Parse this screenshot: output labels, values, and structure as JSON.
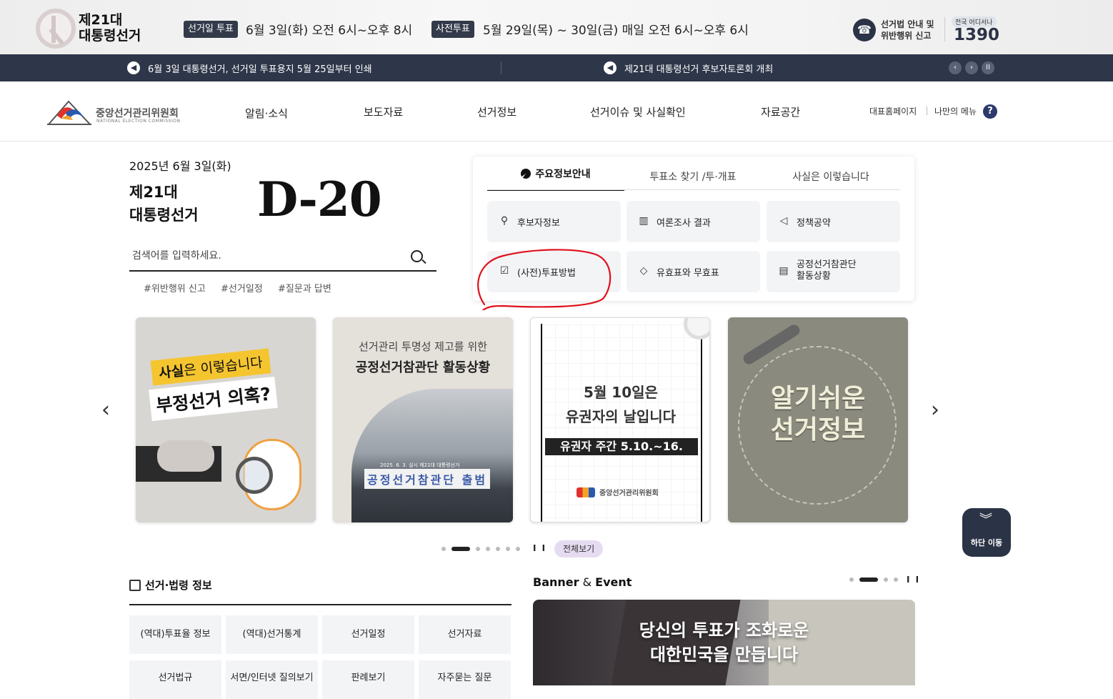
{
  "top_banner": {
    "title_line1": "제21대",
    "title_line2": "대통령선거",
    "election_day_badge": "선거일 투표",
    "election_day_text": "6월 3일(화) 오전 6시~오후 8시",
    "early_vote_badge": "사전투표",
    "early_vote_text": "5월 29일(목) ~ 30일(금) 매일 오전 6시~오후 6시",
    "hotline_line1": "선거법 안내 및",
    "hotline_line2": "위반행위 신고",
    "hotline_anywhere": "전국 어디서나",
    "hotline_number": "1390"
  },
  "ticker": {
    "items": [
      "6월 3일 대통령선거, 선거일 투표용지 5월 25일부터 인쇄",
      "제21대 대통령선거 후보자토론회 개최"
    ]
  },
  "nav": {
    "org_name": "중앙선거관리위원회",
    "org_name_en": "NATIONAL ELECTION COMMISSION",
    "items": [
      "알림·소식",
      "보도자료",
      "선거정보",
      "선거이슈 및 사실확인",
      "자료공간"
    ],
    "util_home": "대표홈페이지",
    "util_mymenu": "나만의 메뉴",
    "help": "?"
  },
  "hero": {
    "date": "2025년 6월 3일(화)",
    "election_line1": "제21대",
    "election_line2": "대통령선거",
    "dday": "D-20",
    "search_placeholder": "검색어를 입력하세요.",
    "hashtags": [
      "#위반행위 신고",
      "#선거일정",
      "#질문과 답변"
    ]
  },
  "info_panel": {
    "tabs": [
      "주요정보안내",
      "투표소 찾기 /투·개표",
      "사실은 이렇습니다"
    ],
    "buttons": [
      {
        "label": "후보자정보",
        "icon": "person-search-icon"
      },
      {
        "label": "여론조사 결과",
        "icon": "bar-chart-icon"
      },
      {
        "label": "정책공약",
        "icon": "megaphone-icon"
      },
      {
        "label": "(사전)투표방법",
        "icon": "ballot-box-icon"
      },
      {
        "label": "유효표와 무효표",
        "icon": "stamp-icon"
      },
      {
        "label": "공정선거참관단 활동상황",
        "label_line1": "공정선거참관단",
        "label_line2": "활동상황",
        "icon": "document-icon"
      }
    ]
  },
  "carousel": {
    "prev": "‹",
    "next": "›",
    "card1": {
      "tag_bold": "사실",
      "tag_rest": "은 이렇습니다",
      "title": "부정선거 의혹?"
    },
    "card2": {
      "sub": "선거관리 투명성 제고를 위한",
      "title": "공정선거참관단 활동상황",
      "photo_date": "2025. 6. 3. 실시 제21대 대통령선거",
      "photo_banner": "공정선거참관단 출범"
    },
    "card3": {
      "line1": "5월 10일은",
      "line2": "유권자의 날입니다",
      "band": "유권자 주간  5.10.~16.",
      "org": "중앙선거관리위원회"
    },
    "card4": {
      "line1": "알기쉬운",
      "line2": "선거정보"
    },
    "pause": "I I",
    "view_all": "전체보기"
  },
  "move_down": {
    "label": "하단 이동"
  },
  "law_section": {
    "title": "선거·법령 정보",
    "buttons": [
      "(역대)투표율 정보",
      "(역대)선거통계",
      "선거일정",
      "선거자료",
      "선거법규",
      "서면/인터넷 질의보기",
      "판례보기",
      "자주묻는 질문"
    ]
  },
  "banner_section": {
    "title_a": "Banner",
    "title_amp": " & ",
    "title_b": "Event",
    "pause": "I I",
    "text_line1": "당신의 투표가 조화로운",
    "text_line2": "대한민국을 만듭니다"
  },
  "colors": {
    "navy": "#2e3649",
    "annotation_red": "#e0101a",
    "view_all_bg": "#e6dcf2"
  }
}
